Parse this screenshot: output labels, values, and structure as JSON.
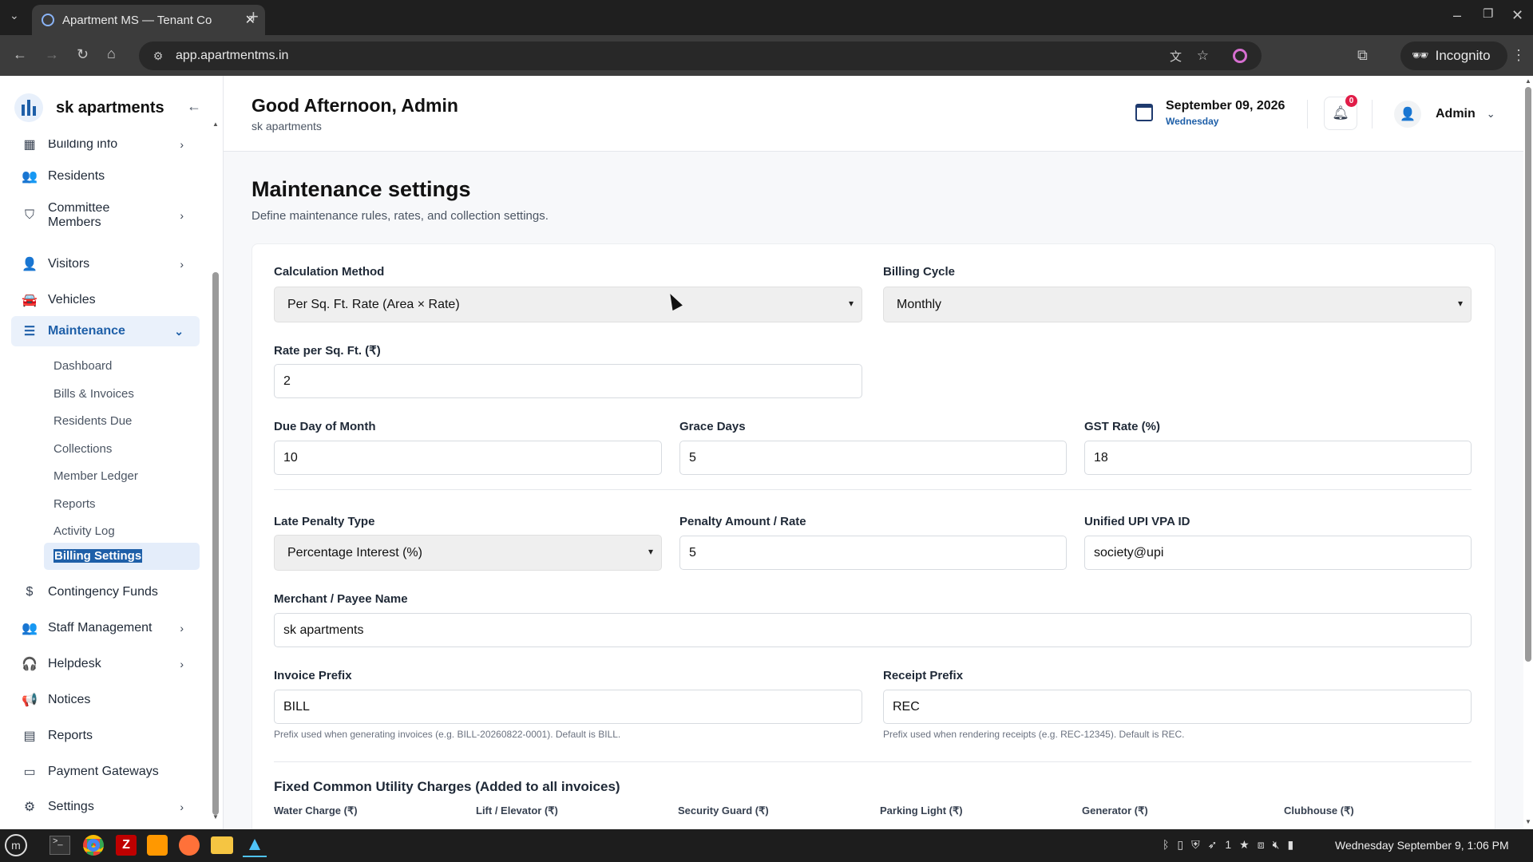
{
  "browser": {
    "tab_title": "Apartment MS — Tenant Co",
    "url": "app.apartmentms.in",
    "incognito_label": "Incognito"
  },
  "sidebar": {
    "brand": "sk apartments",
    "items": [
      {
        "label": "Building info",
        "icon": "grid-icon"
      },
      {
        "label": "Residents",
        "icon": "users-icon"
      },
      {
        "label": "Committee",
        "label2": "Members",
        "icon": "shield-icon"
      },
      {
        "label": "Visitors",
        "icon": "user-plus-icon"
      },
      {
        "label": "Vehicles",
        "icon": "car-icon"
      },
      {
        "label": "Maintenance",
        "icon": "layers-icon"
      },
      {
        "label": "Contingency Funds",
        "icon": "dollar-icon"
      },
      {
        "label": "Staff Management",
        "icon": "staff-icon"
      },
      {
        "label": "Helpdesk",
        "icon": "headset-icon"
      },
      {
        "label": "Notices",
        "icon": "megaphone-icon"
      },
      {
        "label": "Reports",
        "icon": "chart-icon"
      },
      {
        "label": "Payment Gateways",
        "icon": "card-icon"
      },
      {
        "label": "Settings",
        "icon": "gear-icon"
      }
    ],
    "maintenance_sub": [
      "Dashboard",
      "Bills & Invoices",
      "Residents Due",
      "Collections",
      "Member Ledger",
      "Reports",
      "Activity Log",
      "Billing Settings"
    ]
  },
  "header": {
    "greeting": "Good Afternoon, Admin",
    "subtitle": "sk apartments",
    "date": "September 09, 2026",
    "weekday": "Wednesday",
    "notifications": "0",
    "user": "Admin"
  },
  "page": {
    "title": "Maintenance settings",
    "subtitle": "Define maintenance rules, rates, and collection settings."
  },
  "form": {
    "calc_method_label": "Calculation Method",
    "calc_method_value": "Per Sq. Ft. Rate (Area × Rate)",
    "billing_cycle_label": "Billing Cycle",
    "billing_cycle_value": "Monthly",
    "rate_label": "Rate per Sq. Ft. (₹)",
    "rate_value": "2",
    "due_day_label": "Due Day of Month",
    "due_day_value": "10",
    "grace_label": "Grace Days",
    "grace_value": "5",
    "gst_label": "GST Rate (%)",
    "gst_value": "18",
    "penalty_type_label": "Late Penalty Type",
    "penalty_type_value": "Percentage Interest (%)",
    "penalty_amount_label": "Penalty Amount / Rate",
    "penalty_amount_value": "5",
    "upi_label": "Unified UPI VPA ID",
    "upi_value": "society@upi",
    "payee_label": "Merchant / Payee Name",
    "payee_value": "sk apartments",
    "invoice_prefix_label": "Invoice Prefix",
    "invoice_prefix_value": "BILL",
    "invoice_hint": "Prefix used when generating invoices (e.g. BILL-20260822-0001). Default is BILL.",
    "receipt_prefix_label": "Receipt Prefix",
    "receipt_prefix_value": "REC",
    "receipt_hint": "Prefix used when rendering receipts (e.g. REC-12345). Default is REC.",
    "utility_title": "Fixed Common Utility Charges (Added to all invoices)",
    "utility_labels": [
      "Water Charge (₹)",
      "Lift / Elevator (₹)",
      "Security Guard (₹)",
      "Parking Light (₹)",
      "Generator (₹)",
      "Clubhouse (₹)"
    ]
  },
  "taskbar": {
    "clock": "Wednesday September 9, 1:06 PM",
    "workspace": "1"
  }
}
